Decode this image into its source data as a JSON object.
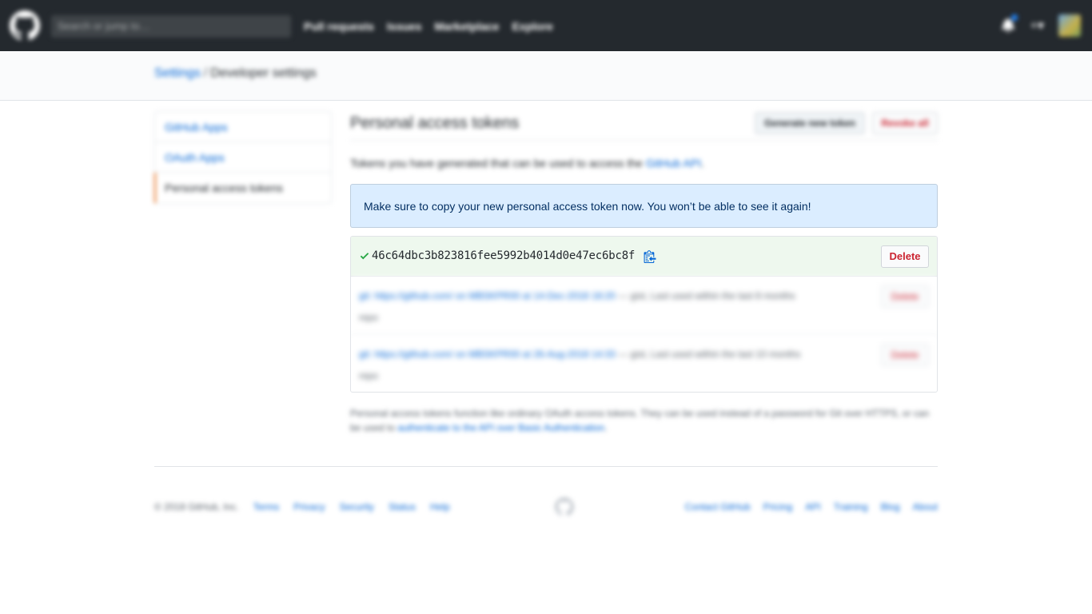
{
  "header": {
    "search_placeholder": "Search or jump to…",
    "nav": [
      "Pull requests",
      "Issues",
      "Marketplace",
      "Explore"
    ],
    "plus_label": "+▾"
  },
  "breadcrumb": {
    "parent": "Settings",
    "separator": "/",
    "current": "Developer settings"
  },
  "sidebar": {
    "items": [
      {
        "label": "GitHub Apps"
      },
      {
        "label": "OAuth Apps"
      },
      {
        "label": "Personal access tokens"
      }
    ]
  },
  "main": {
    "title": "Personal access tokens",
    "generate_label": "Generate new token",
    "revoke_label": "Revoke all",
    "desc_text": "Tokens you have generated that can be used to access the ",
    "desc_link": "GitHub API",
    "desc_end": "."
  },
  "flash": {
    "message": "Make sure to copy your new personal access token now. You won’t be able to see it again!"
  },
  "new_token": {
    "value": "46c64dbc3b823816fee5992b4014d0e47ec6bc8f",
    "delete_label": "Delete"
  },
  "tokens": [
    {
      "name": "git: https://github.com/ on MBSKPR00 at 14-Dec-2018 18:20",
      "scope": " — gist,",
      "usage": " Last used within the last 8 months",
      "extra": "repo",
      "delete_label": "Delete"
    },
    {
      "name": "git: https://github.com/ on MBSKPR00 at 26-Aug-2018 14:33",
      "scope": " — gist,",
      "usage": " Last used within the last 10 months",
      "extra": "repo",
      "delete_label": "Delete"
    }
  ],
  "footnote": {
    "text": "Personal access tokens function like ordinary OAuth access tokens. They can be used instead of a password for Git over HTTPS, or can be used to ",
    "link": "authenticate to the API over Basic Authentication",
    "end": "."
  },
  "footer": {
    "copyright": "© 2018 GitHub, Inc.",
    "left_links": [
      "Terms",
      "Privacy",
      "Security",
      "Status",
      "Help"
    ],
    "right_links": [
      "Contact GitHub",
      "Pricing",
      "API",
      "Training",
      "Blog",
      "About"
    ]
  },
  "colors": {
    "header_bg": "#24292e",
    "link": "#0366d6",
    "danger": "#cb2431",
    "flash_bg": "#dbedff",
    "success_bg": "#eef8ee",
    "success_icon": "#28a745",
    "selected_indicator": "#e36209"
  },
  "icons": {
    "logo": "github-octocat-icon",
    "check": "check-icon",
    "clipboard": "clipboard-icon",
    "bell": "bell-icon",
    "footer_mark": "github-mark-icon"
  }
}
